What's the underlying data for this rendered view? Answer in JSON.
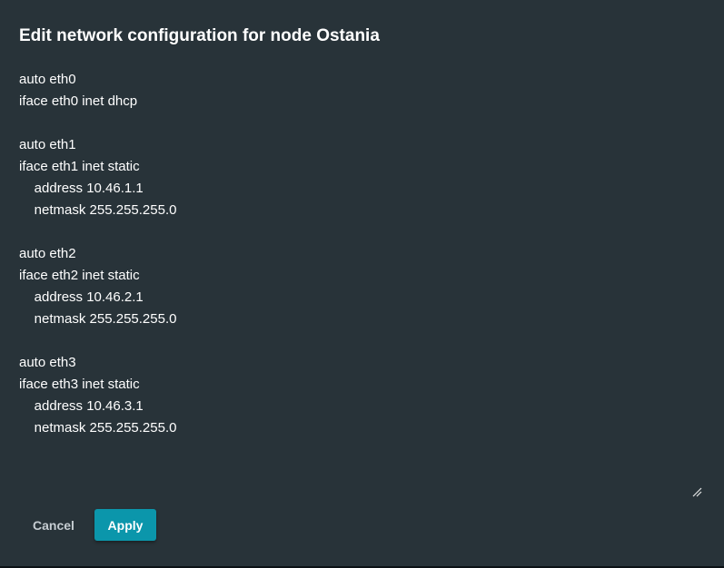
{
  "dialog": {
    "title": "Edit network configuration for node Ostania",
    "config_text": "auto eth0\niface eth0 inet dhcp\n\nauto eth1\niface eth1 inet static\n\taddress 10.46.1.1\n\tnetmask 255.255.255.0\n\nauto eth2\niface eth2 inet static\n\taddress 10.46.2.1\n\tnetmask 255.255.255.0\n\nauto eth3\niface eth3 inet static\n\taddress 10.46.3.1\n\tnetmask 255.255.255.0",
    "cancel_label": "Cancel",
    "apply_label": "Apply",
    "resize_icon": "resize-grip-icon"
  },
  "colors": {
    "dialog_background": "#283339",
    "text": "#ffffff",
    "cancel_text": "#c6cdd2",
    "accent": "#0b96ab"
  }
}
